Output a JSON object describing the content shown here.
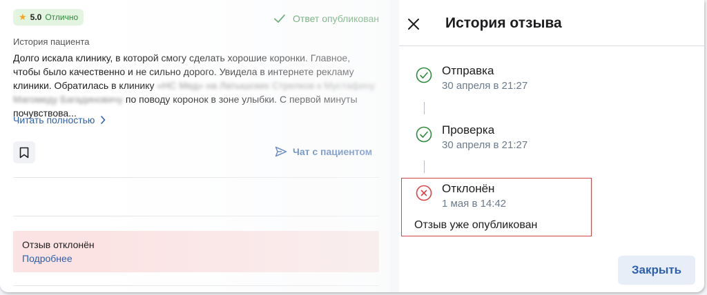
{
  "review": {
    "rating_score": "5.0",
    "rating_label": "Отлично",
    "status": "Ответ опубликован",
    "section_label": "История пациента",
    "text_part1": "Долго искала клинику, в которой смогу сделать хорошие коронки. Главное, чтобы было качественно и не сильно дорого. Увидела в интернете рекламу клиники. Обратилась в клинику ",
    "text_blurred": "«НС Мед» на Латышских Стрелков к Мустафину Магомеду Багадиновичу",
    "text_part2": " по поводу коронок в зоне улыбки. С первой минуты почувствова...",
    "read_more": "Читать полностью",
    "chat_label": "Чат с пациентом"
  },
  "rejection": {
    "title": "Отзыв отклонён",
    "link": "Подробнее"
  },
  "history_panel": {
    "title": "История отзыва",
    "steps": [
      {
        "name": "Отправка",
        "date": "30 апреля в 21:27",
        "status": "ok"
      },
      {
        "name": "Проверка",
        "date": "30 апреля в 21:27",
        "status": "ok"
      },
      {
        "name": "Отклонён",
        "date": "1 мая в 14:42",
        "status": "rejected"
      }
    ],
    "reason": "Отзыв уже опубликован",
    "close_button": "Закрыть"
  },
  "colors": {
    "success": "#2e8a3a",
    "error": "#d64545",
    "link": "#2d5fab",
    "rejected_bg": "#fbe3e3"
  }
}
